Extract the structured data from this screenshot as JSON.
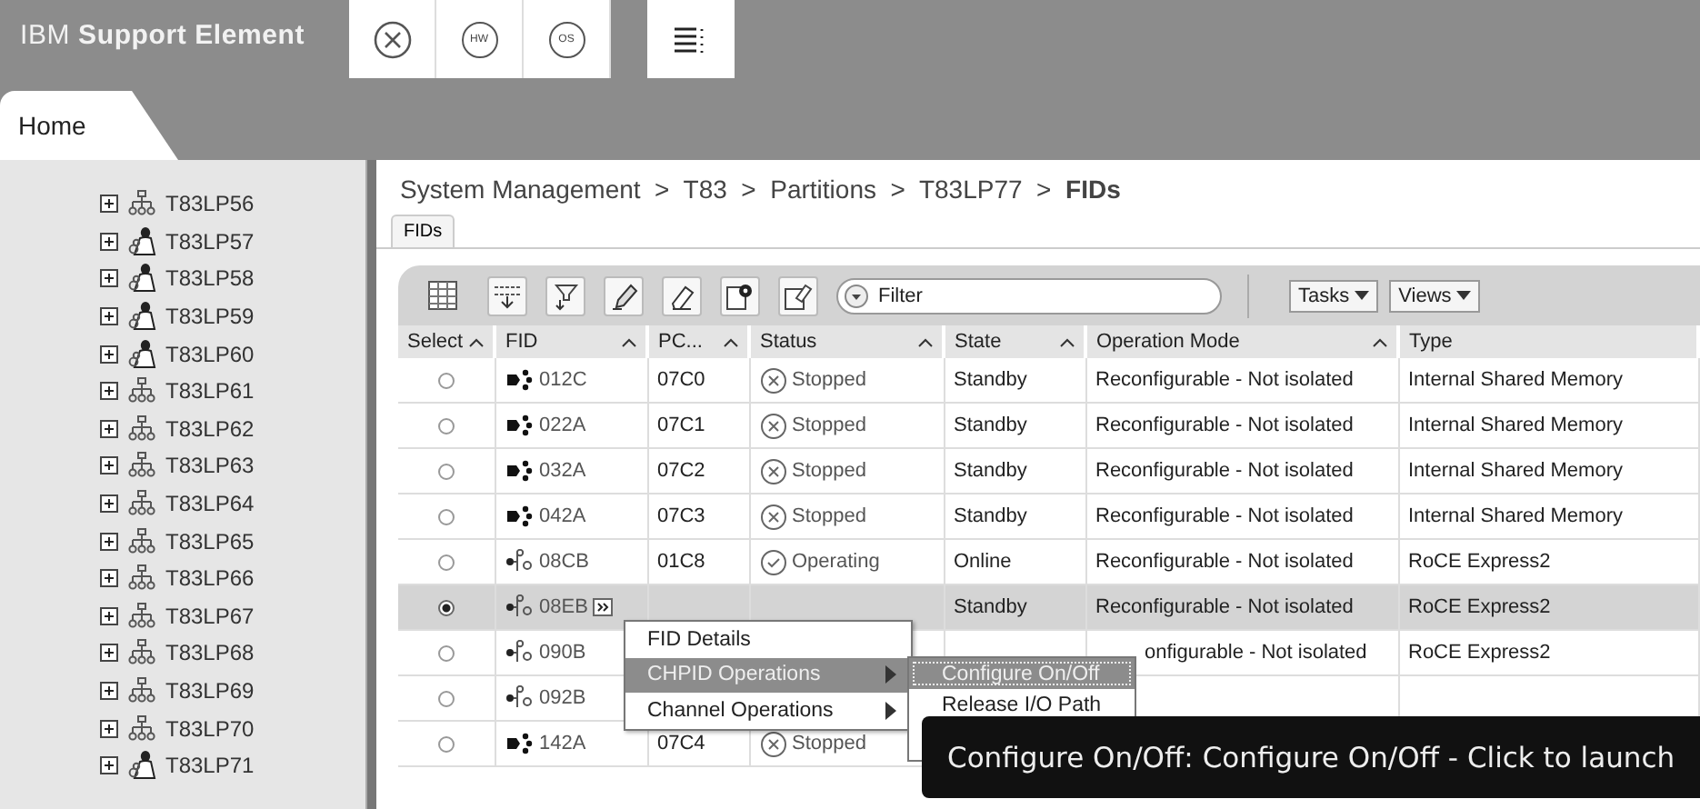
{
  "header": {
    "title": "IBM **Support Element**",
    "tools": [
      {
        "kind": "close"
      },
      {
        "kind": "badge",
        "label": "HW"
      },
      {
        "kind": "badge",
        "label": "OS"
      },
      {
        "kind": "menu"
      }
    ]
  },
  "tabs": [
    {
      "label": "Home",
      "selected": true
    }
  ],
  "tree": [
    {
      "label": "T83LP56",
      "kind": "network"
    },
    {
      "label": "T83LP57",
      "kind": "linux"
    },
    {
      "label": "T83LP58",
      "kind": "linux"
    },
    {
      "label": "T83LP59",
      "kind": "linux"
    },
    {
      "label": "T83LP60",
      "kind": "linux"
    },
    {
      "label": "T83LP61",
      "kind": "network"
    },
    {
      "label": "T83LP62",
      "kind": "network"
    },
    {
      "label": "T83LP63",
      "kind": "network"
    },
    {
      "label": "T83LP64",
      "kind": "network"
    },
    {
      "label": "T83LP65",
      "kind": "network"
    },
    {
      "label": "T83LP66",
      "kind": "network"
    },
    {
      "label": "T83LP67",
      "kind": "network"
    },
    {
      "label": "T83LP68",
      "kind": "network"
    },
    {
      "label": "T83LP69",
      "kind": "network"
    },
    {
      "label": "T83LP70",
      "kind": "network"
    },
    {
      "label": "T83LP71",
      "kind": "linux"
    }
  ],
  "breadcrumb": "System Management  >  T83  >  Partitions  >  T83LP77  >  **FIDs**",
  "panel_tabs": [
    "FIDs"
  ],
  "toolbar": {
    "filter_placeholder": "Filter",
    "buttons": [
      "Tasks",
      "Views"
    ]
  },
  "table": {
    "columns": [
      {
        "label": "Select",
        "sort_icon": true
      },
      {
        "label": "FID",
        "sort_icon": true
      },
      {
        "label": "PC...",
        "sort_icon": true
      },
      {
        "label": "Status",
        "sort_icon": true
      },
      {
        "label": "State",
        "sort_icon": true
      },
      {
        "label": "Operation Mode",
        "sort_icon": true
      },
      {
        "label": "Type",
        "sort_icon": false
      }
    ],
    "rows": [
      {
        "selected": false,
        "kind": "ism",
        "fid": "012C",
        "pc": "07C0",
        "status": {
          "text": "Stopped",
          "kind": "stopped"
        },
        "state": "Standby",
        "mode": "Reconfigurable - Not isolated",
        "type": "Internal Shared Memory"
      },
      {
        "selected": false,
        "kind": "ism",
        "fid": "022A",
        "pc": "07C1",
        "status": {
          "text": "Stopped",
          "kind": "stopped"
        },
        "state": "Standby",
        "mode": "Reconfigurable - Not isolated",
        "type": "Internal Shared Memory"
      },
      {
        "selected": false,
        "kind": "ism",
        "fid": "032A",
        "pc": "07C2",
        "status": {
          "text": "Stopped",
          "kind": "stopped"
        },
        "state": "Standby",
        "mode": "Reconfigurable - Not isolated",
        "type": "Internal Shared Memory"
      },
      {
        "selected": false,
        "kind": "ism",
        "fid": "042A",
        "pc": "07C3",
        "status": {
          "text": "Stopped",
          "kind": "stopped"
        },
        "state": "Standby",
        "mode": "Reconfigurable - Not isolated",
        "type": "Internal Shared Memory"
      },
      {
        "selected": false,
        "kind": "roce",
        "fid": "08CB",
        "pc": "01C8",
        "status": {
          "text": "Operating",
          "kind": "operating"
        },
        "state": "Online",
        "mode": "Reconfigurable - Not isolated",
        "type": "RoCE Express2"
      },
      {
        "selected": true,
        "kind": "roce",
        "fid": "08EB",
        "menu_trigger": true,
        "state": "Standby",
        "mode": "Reconfigurable - Not isolated",
        "type": "RoCE Express2"
      },
      {
        "selected": false,
        "kind": "roce",
        "fid": "090B",
        "mode": "onfigurable - Not isolated",
        "mode_cut": true,
        "type": "RoCE Express2"
      },
      {
        "selected": false,
        "kind": "roce",
        "fid": "092B"
      },
      {
        "selected": false,
        "kind": "ism",
        "fid": "142A",
        "pc": "07C4",
        "status": {
          "text": "Stopped",
          "kind": "stopped"
        }
      }
    ]
  },
  "context_menu": {
    "items": [
      {
        "label": "FID Details",
        "selected": false,
        "submenu": false
      },
      {
        "label": "CHPID Operations",
        "selected": true,
        "submenu": true
      },
      {
        "label": "Channel Operations",
        "selected": false,
        "submenu": true
      }
    ],
    "submenu": [
      {
        "label": "Configure On/Off",
        "selected": true
      },
      {
        "label": "Release I/O Path",
        "selected": false
      }
    ]
  },
  "tooltip": "Configure On/Off: Configure On/Off - Click to launch"
}
